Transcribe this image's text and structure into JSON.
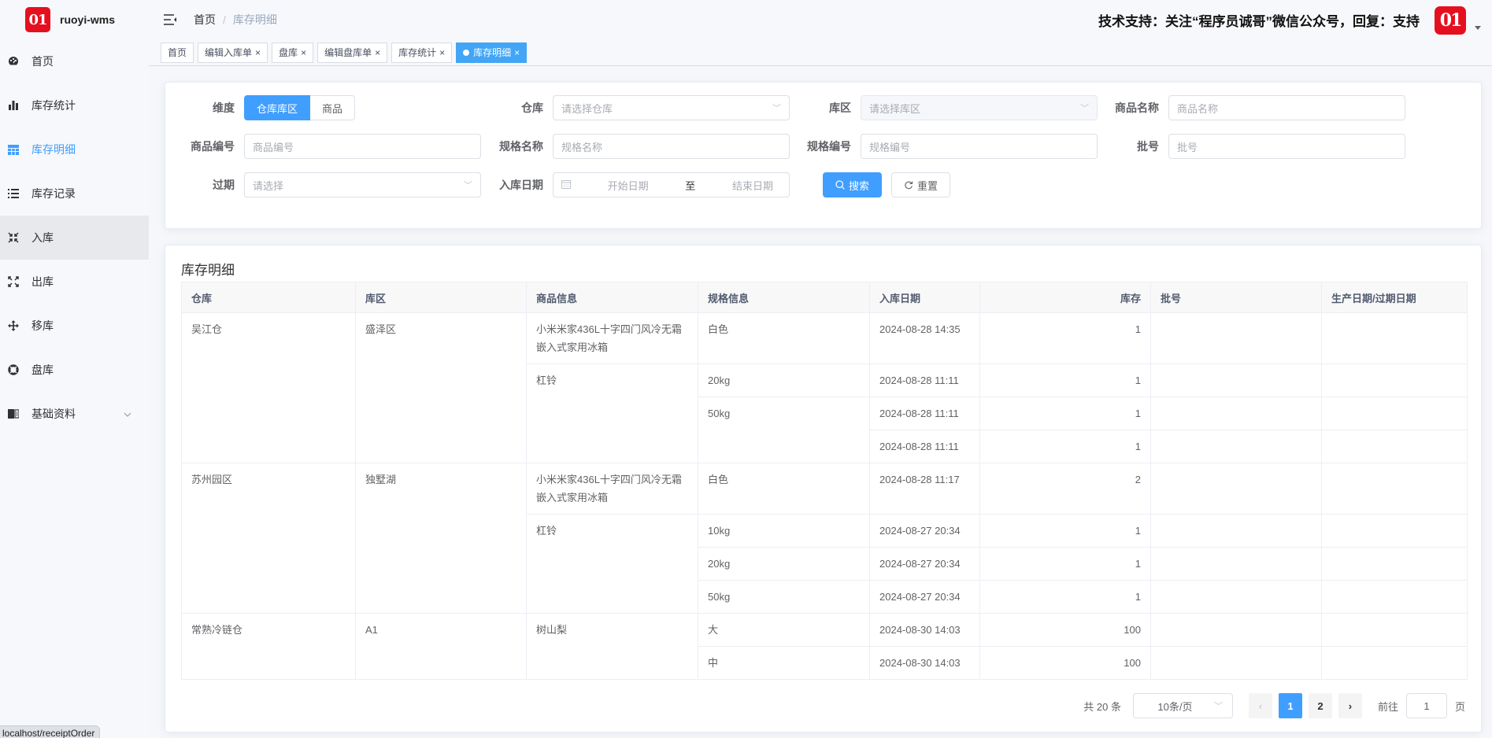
{
  "app": {
    "name": "ruoyi-wms",
    "logo_text": "01",
    "brand_color": "#e5101f",
    "accent_color": "#409eff"
  },
  "header": {
    "breadcrumb": [
      "首页",
      "库存明细"
    ],
    "support_text": "技术支持：关注“程序员诚哥”微信公众号，回复：支持",
    "avatar_text": "01"
  },
  "sidebar": {
    "items": [
      {
        "label": "首页",
        "icon": "dashboard-icon"
      },
      {
        "label": "库存统计",
        "icon": "bar-chart-icon"
      },
      {
        "label": "库存明细",
        "icon": "grid-icon",
        "active": true
      },
      {
        "label": "库存记录",
        "icon": "list-icon"
      },
      {
        "label": "入库",
        "icon": "collapse-arrows-icon",
        "hover": true
      },
      {
        "label": "出库",
        "icon": "expand-arrows-icon"
      },
      {
        "label": "移库",
        "icon": "move-icon"
      },
      {
        "label": "盘库",
        "icon": "lifebuoy-icon"
      },
      {
        "label": "基础资料",
        "icon": "book-icon",
        "has_children": true
      }
    ]
  },
  "tags": [
    {
      "label": "首页",
      "closable": false
    },
    {
      "label": "编辑入库单",
      "closable": true
    },
    {
      "label": "盘库",
      "closable": true
    },
    {
      "label": "编辑盘库单",
      "closable": true
    },
    {
      "label": "库存统计",
      "closable": true
    },
    {
      "label": "库存明细",
      "closable": true,
      "active": true
    }
  ],
  "filters": {
    "dimension": {
      "label": "维度",
      "options": [
        "仓库库区",
        "商品"
      ],
      "selected": "仓库库区"
    },
    "warehouse": {
      "label": "仓库",
      "placeholder": "请选择仓库"
    },
    "area": {
      "label": "库区",
      "placeholder": "请选择库区",
      "disabled": true
    },
    "item_name": {
      "label": "商品名称",
      "placeholder": "商品名称"
    },
    "item_code": {
      "label": "商品编号",
      "placeholder": "商品编号"
    },
    "sku_name": {
      "label": "规格名称",
      "placeholder": "规格名称"
    },
    "sku_code": {
      "label": "规格编号",
      "placeholder": "规格编号"
    },
    "batch": {
      "label": "批号",
      "placeholder": "批号"
    },
    "expiry": {
      "label": "过期",
      "placeholder": "请选择"
    },
    "receipt_date": {
      "label": "入库日期",
      "start_placeholder": "开始日期",
      "separator": "至",
      "end_placeholder": "结束日期"
    },
    "search_label": "搜索",
    "reset_label": "重置"
  },
  "table": {
    "title": "库存明细",
    "columns": [
      "仓库",
      "库区",
      "商品信息",
      "规格信息",
      "入库日期",
      "库存",
      "批号",
      "生产日期/过期日期"
    ],
    "rows": [
      {
        "warehouse": "吴江仓",
        "area": "盛泽区",
        "item": "小米米家436L十字四门风冷无霜嵌入式家用冰箱",
        "sku": "白色",
        "date": "2024-08-28 14:35",
        "qty": "1",
        "batch": "",
        "prod_exp": ""
      },
      {
        "warehouse": "吴江仓",
        "area": "盛泽区",
        "item": "杠铃",
        "sku": "20kg",
        "date": "2024-08-28 11:11",
        "qty": "1",
        "batch": "",
        "prod_exp": ""
      },
      {
        "warehouse": "吴江仓",
        "area": "盛泽区",
        "item": "杠铃",
        "sku": "50kg",
        "date": "2024-08-28 11:11",
        "qty": "1",
        "batch": "",
        "prod_exp": ""
      },
      {
        "warehouse": "吴江仓",
        "area": "盛泽区",
        "item": "杠铃",
        "sku": "50kg",
        "date": "2024-08-28 11:11",
        "qty": "1",
        "batch": "",
        "prod_exp": ""
      },
      {
        "warehouse": "苏州园区",
        "area": "独墅湖",
        "item": "小米米家436L十字四门风冷无霜嵌入式家用冰箱",
        "sku": "白色",
        "date": "2024-08-28 11:17",
        "qty": "2",
        "batch": "",
        "prod_exp": ""
      },
      {
        "warehouse": "苏州园区",
        "area": "独墅湖",
        "item": "杠铃",
        "sku": "10kg",
        "date": "2024-08-27 20:34",
        "qty": "1",
        "batch": "",
        "prod_exp": ""
      },
      {
        "warehouse": "苏州园区",
        "area": "独墅湖",
        "item": "杠铃",
        "sku": "20kg",
        "date": "2024-08-27 20:34",
        "qty": "1",
        "batch": "",
        "prod_exp": ""
      },
      {
        "warehouse": "苏州园区",
        "area": "独墅湖",
        "item": "杠铃",
        "sku": "50kg",
        "date": "2024-08-27 20:34",
        "qty": "1",
        "batch": "",
        "prod_exp": ""
      },
      {
        "warehouse": "常熟冷链仓",
        "area": "A1",
        "item": "树山梨",
        "sku": "大",
        "date": "2024-08-30 14:03",
        "qty": "100",
        "batch": "",
        "prod_exp": ""
      },
      {
        "warehouse": "常熟冷链仓",
        "area": "A1",
        "item": "树山梨",
        "sku": "中",
        "date": "2024-08-30 14:03",
        "qty": "100",
        "batch": "",
        "prod_exp": ""
      }
    ]
  },
  "pagination": {
    "total_text": "共 20 条",
    "page_size": "10条/页",
    "pages": [
      "1",
      "2"
    ],
    "current": "1",
    "goto_label": "前往",
    "goto_value": "1",
    "page_suffix": "页"
  },
  "status_bar": {
    "url": "localhost/receiptOrder"
  }
}
